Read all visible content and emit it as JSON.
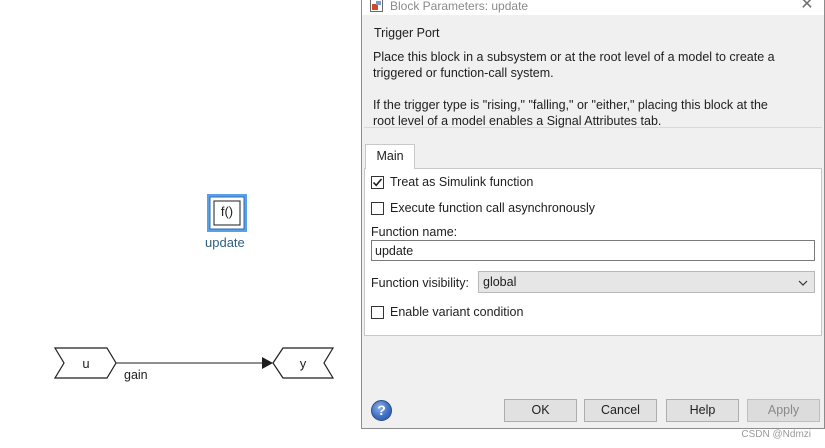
{
  "canvas": {
    "function_block": {
      "glyph": "f()",
      "name": "update"
    },
    "inport": {
      "label": "u"
    },
    "outport": {
      "label": "y"
    },
    "signal_label": "gain"
  },
  "dialog": {
    "title": "Block Parameters: update",
    "close_glyph": "✕",
    "heading": "Trigger Port",
    "description_1_line_1": "Place this block in a subsystem or at the root level of a model to create a",
    "description_1_line_2": "triggered or function-call system.",
    "description_2_line_1": "If the trigger type is \"rising,\" \"falling,\" or \"either,\" placing this block at the",
    "description_2_line_2": "root level of a model enables a Signal Attributes tab.",
    "tabs": [
      {
        "label": "Main",
        "active": true
      }
    ],
    "treat_as_simulink_function": {
      "label": "Treat as Simulink function",
      "checked": true
    },
    "execute_async": {
      "label": "Execute function call asynchronously",
      "checked": false
    },
    "function_name": {
      "label": "Function name:",
      "value": "update"
    },
    "function_visibility": {
      "label": "Function visibility:",
      "value": "global"
    },
    "enable_variant": {
      "label": "Enable variant condition",
      "checked": false
    },
    "buttons": {
      "ok": "OK",
      "cancel": "Cancel",
      "help": "Help",
      "apply": "Apply"
    },
    "help_icon_glyph": "?"
  },
  "watermark": "CSDN @Ndmzi",
  "colors": {
    "block_selection": "#5aa0e6",
    "block_name": "#2f5f7f",
    "dialog_bg": "#f0f0f0",
    "button_bg": "#e1e1e1"
  },
  "icons": {
    "title_icon": "block-parameters-icon",
    "close": "close-icon",
    "chevron": "chevron-down-icon",
    "help": "help-icon",
    "checkmark": "checkmark-icon"
  }
}
